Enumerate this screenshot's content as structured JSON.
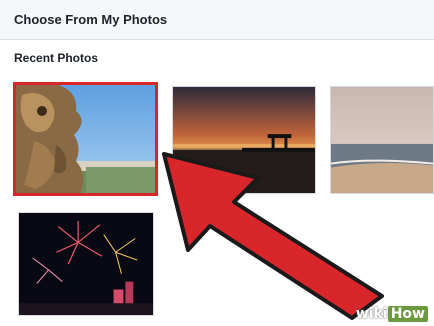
{
  "dialog": {
    "title": "Choose From My Photos",
    "section_title": "Recent Photos"
  },
  "photos": [
    {
      "subject": "stone-lion-statue-photo",
      "selected": true
    },
    {
      "subject": "sunset-pier-photo",
      "selected": false
    },
    {
      "subject": "beach-photo",
      "selected": false
    },
    {
      "subject": "fireworks-photo",
      "selected": false
    }
  ],
  "colors": {
    "selection_border": "#d9262b",
    "arrow_fill": "#d9262b",
    "arrow_stroke": "#1a1a1a",
    "header_bg": "#f6f7f9"
  },
  "watermark": {
    "part_a": "wiki",
    "part_b": "How"
  }
}
